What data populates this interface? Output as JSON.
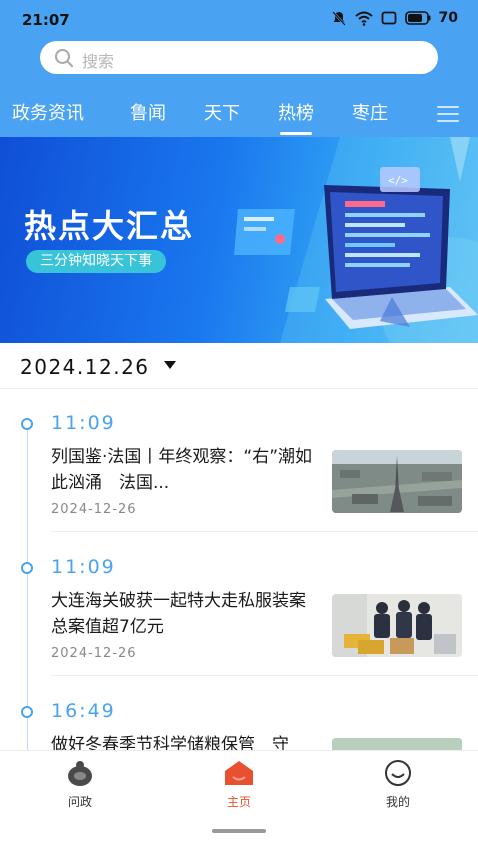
{
  "status_bar": {
    "time": "21:07",
    "battery": "70"
  },
  "search": {
    "placeholder": "搜索"
  },
  "tabs": [
    {
      "label": "政务资讯",
      "active": false
    },
    {
      "label": "鲁闻",
      "active": false
    },
    {
      "label": "天下",
      "active": false
    },
    {
      "label": "热榜",
      "active": true
    },
    {
      "label": "枣庄",
      "active": false
    }
  ],
  "banner": {
    "title": "热点大汇总",
    "subtitle": "三分钟知晓天下事"
  },
  "date_selector": {
    "value": "2024.12.26"
  },
  "news": [
    {
      "time": "11:09",
      "title": "列国鉴·法国丨年终观察：“右”潮如此汹涌　法国...",
      "date": "2024-12-26",
      "thumb": "paris-eiffel-aerial"
    },
    {
      "time": "11:09",
      "title": "大连海关破获一起特大走私服装案　总案值超7亿元",
      "date": "2024-12-26",
      "thumb": "customs-officers-boxes"
    },
    {
      "time": "16:49",
      "title": "做好冬春季节科学储粮保管　守",
      "date": "",
      "thumb": "grain-storage"
    }
  ],
  "bottom_nav": [
    {
      "label": "问政",
      "icon": "ask-icon",
      "active": false
    },
    {
      "label": "主页",
      "icon": "home-icon",
      "active": true
    },
    {
      "label": "我的",
      "icon": "profile-icon",
      "active": false
    }
  ],
  "colors": {
    "header": "#4aa3f2",
    "accent": "#4aa3f2",
    "nav_active": "#e8502f"
  }
}
